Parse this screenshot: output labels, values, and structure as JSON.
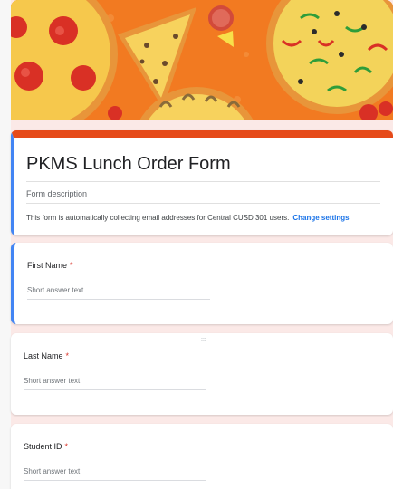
{
  "form": {
    "title": "PKMS Lunch Order Form",
    "description_placeholder": "Form description",
    "email_notice": "This form is automatically collecting email addresses for Central CUSD 301 users.",
    "change_settings_label": "Change settings"
  },
  "questions": [
    {
      "label": "First Name",
      "required_mark": "*",
      "placeholder": "Short answer text"
    },
    {
      "label": "Last Name",
      "required_mark": "*",
      "placeholder": "Short answer text"
    },
    {
      "label": "Student ID",
      "required_mark": "*",
      "placeholder": "Short answer text"
    }
  ],
  "drag_handle_glyph": ":::",
  "colors": {
    "theme_accent": "#e64a19",
    "selected_border": "#4285f4",
    "link": "#1a73e8",
    "required": "#d93025",
    "page_background": "#fbe9e7"
  }
}
